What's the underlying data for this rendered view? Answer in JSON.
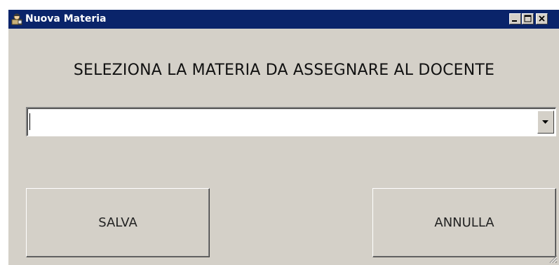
{
  "window": {
    "title": "Nuova Materia",
    "icon": "teacher-app-icon",
    "controls": [
      "minimize-icon",
      "maximize-icon",
      "close-icon"
    ]
  },
  "form": {
    "heading": "SELEZIONA LA MATERIA DA ASSEGNARE AL DOCENTE",
    "subject_combo": {
      "value": "",
      "options": []
    }
  },
  "buttons": {
    "save_label": "SALVA",
    "cancel_label": "ANNULLA"
  },
  "colors": {
    "titlebar": "#0a246a",
    "face": "#d4d0c8"
  }
}
